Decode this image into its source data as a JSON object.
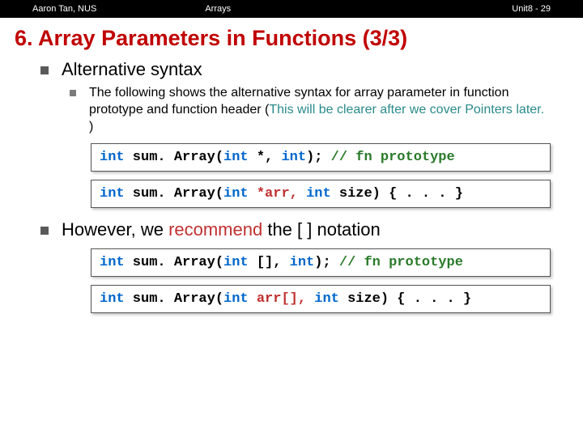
{
  "header": {
    "left": "Aaron Tan, NUS",
    "center": "Arrays",
    "right": "Unit8 - 29"
  },
  "title": "6. Array Parameters in Functions (3/3)",
  "b1": "Alternative syntax",
  "b1_sub": {
    "pre": "The following shows the alternative syntax for array parameter in function prototype and function header (",
    "hint": "This will be clearer after we cover Pointers later.",
    "post": " )"
  },
  "code1": {
    "t1": "int",
    "t2": " sum. Array(",
    "t3": "int",
    "t4": " *, ",
    "t5": "int",
    "t6": "); ",
    "t7": "// fn prototype"
  },
  "code2": {
    "t1": "int",
    "t2": " sum. Array(",
    "t3": "int",
    "t4": " *arr, ",
    "t5": "int",
    "t6": " size) { . . . }"
  },
  "b2": {
    "pre": "However, we ",
    "em": "recommend",
    "post": " the [ ] notation"
  },
  "code3": {
    "t1": "int",
    "t2": " sum. Array(",
    "t3": "int",
    "t4": " [], ",
    "t5": "int",
    "t6": "); ",
    "t7": "// fn prototype"
  },
  "code4": {
    "t1": "int",
    "t2": " sum. Array(",
    "t3": "int",
    "t4": " arr[], ",
    "t5": "int",
    "t6": " size) { . . . }"
  }
}
